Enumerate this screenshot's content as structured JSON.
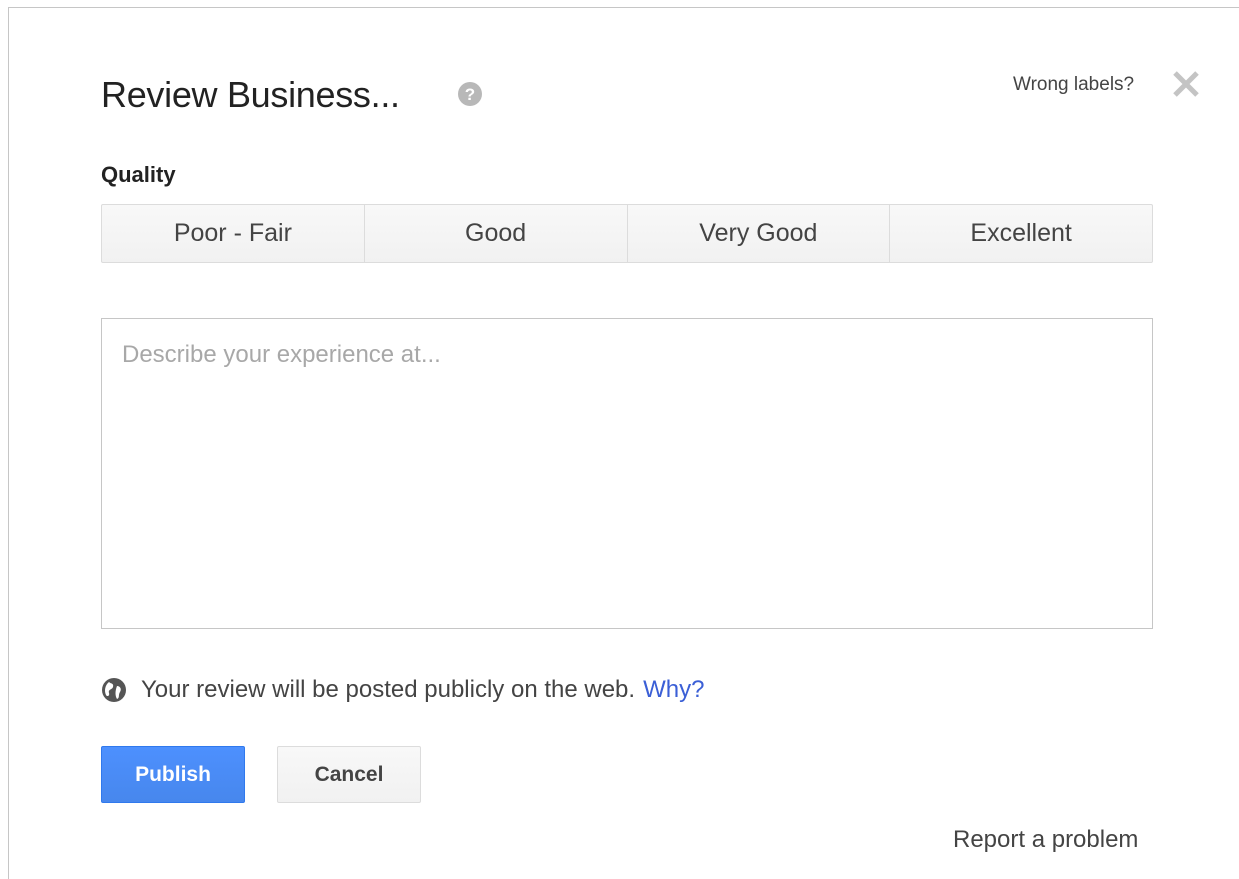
{
  "dialog": {
    "title": "Review Business...",
    "help_icon": "question-circle-icon",
    "wrong_labels": "Wrong labels?",
    "close_icon": "close-x-icon"
  },
  "quality": {
    "label": "Quality",
    "options": [
      "Poor - Fair",
      "Good",
      "Very Good",
      "Excellent"
    ]
  },
  "review": {
    "placeholder": "Describe your experience at...",
    "value": ""
  },
  "public_note": {
    "icon": "globe-icon",
    "text": "Your review will be posted publicly on the web.",
    "link": "Why?"
  },
  "actions": {
    "publish_label": "Publish",
    "cancel_label": "Cancel"
  },
  "footer": {
    "report_label": "Report a problem"
  },
  "colors": {
    "accent": "#4d90fe",
    "link": "#3b5fd6"
  }
}
